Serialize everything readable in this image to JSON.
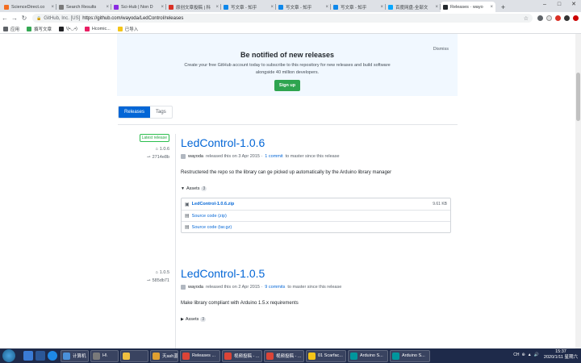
{
  "browser": {
    "tabs": [
      {
        "label": "ScienceDirect.co",
        "color": "#f36d21"
      },
      {
        "label": "Search Results",
        "color": "#7a7a7a"
      },
      {
        "label": "Sci-Hub | Non D",
        "color": "#8a2be2"
      },
      {
        "label": "原创文章投稿 | 科",
        "color": "#d93025"
      },
      {
        "label": "写文章 - 知乎",
        "color": "#0f88eb"
      },
      {
        "label": "写文章 - 知乎",
        "color": "#0f88eb"
      },
      {
        "label": "写文章 - 知乎",
        "color": "#0f88eb"
      },
      {
        "label": "百度网盘-全部文",
        "color": "#06a7ff"
      },
      {
        "label": "Releases · wayo",
        "color": "#24292e"
      }
    ],
    "new_tab": "+",
    "window_controls": [
      "–",
      "□",
      "✕"
    ],
    "address": {
      "org": "GitHub, Inc. [US]",
      "url": "https://github.com/wayoda/LedControl/releases"
    },
    "bookmarks": [
      {
        "label": "应用",
        "color": "#5f6368"
      },
      {
        "label": "撰写文章",
        "color": "#34a853"
      },
      {
        "label": "\\(•◡•)",
        "color": "#202124"
      },
      {
        "label": "Hcomic...",
        "color": "#e91e63"
      },
      {
        "label": "已导入",
        "color": "#f5c518"
      }
    ]
  },
  "signup": {
    "title": "Be notified of new releases",
    "text": "Create your free GitHub account today to subscribe to this repository for new releases and build software alongside 40 million developers.",
    "button": "Sign up",
    "dismiss": "Dismiss"
  },
  "nav_tabs": {
    "releases": "Releases",
    "tags": "Tags"
  },
  "releases": [
    {
      "latest_badge": "Latest release",
      "tag": "1.0.6",
      "commit": "2714e8b",
      "title": "LedControl-1.0.6",
      "author": "wayoda",
      "released_text": "released this on 3 Apr 2015 ·",
      "commits_link": "1 commit",
      "since_text": "to master since this release",
      "description": "Restructered the repo so the library can ge picked up automatically by the Arduino library manager",
      "assets_label": "Assets",
      "assets_count": "3",
      "assets": [
        {
          "name": "LedControl-1.0.6.zip",
          "size": "9.61 KB"
        },
        {
          "name": "Source code (zip)",
          "size": ""
        },
        {
          "name": "Source code (tar.gz)",
          "size": ""
        }
      ]
    },
    {
      "tag": "1.0.5",
      "commit": "585db71",
      "title": "LedControl-1.0.5",
      "author": "wayoda",
      "released_text": "released this on 2 Apr 2015 ·",
      "commits_link": "9 commits",
      "since_text": "to master since this release",
      "description": "Make library compliant with Arduino 1.5.x requirements",
      "assets_label": "Assets",
      "assets_count": "3"
    }
  ],
  "taskbar": {
    "tasks": [
      {
        "label": "计算机",
        "color": "#4a90d9"
      },
      {
        "label": "H\\",
        "color": "#7a7a7a"
      },
      {
        "label": "",
        "color": "#f0c040"
      },
      {
        "label": "天ash蓝盘",
        "color": "#e0a030"
      },
      {
        "label": "Releases ...",
        "color": "#db4437"
      },
      {
        "label": "视频投稿 - ...",
        "color": "#db4437"
      },
      {
        "label": "视频投稿 - ...",
        "color": "#db4437"
      },
      {
        "label": "01 Scarfac...",
        "color": "#f5c518"
      },
      {
        "label": "Arduino S...",
        "color": "#00979d"
      },
      {
        "label": "Arduino S...",
        "color": "#00979d"
      }
    ],
    "tray": [
      "CH",
      "⊕",
      "▲",
      "🔊"
    ],
    "time": "15:37",
    "date": "2020/1/11 星期六"
  }
}
